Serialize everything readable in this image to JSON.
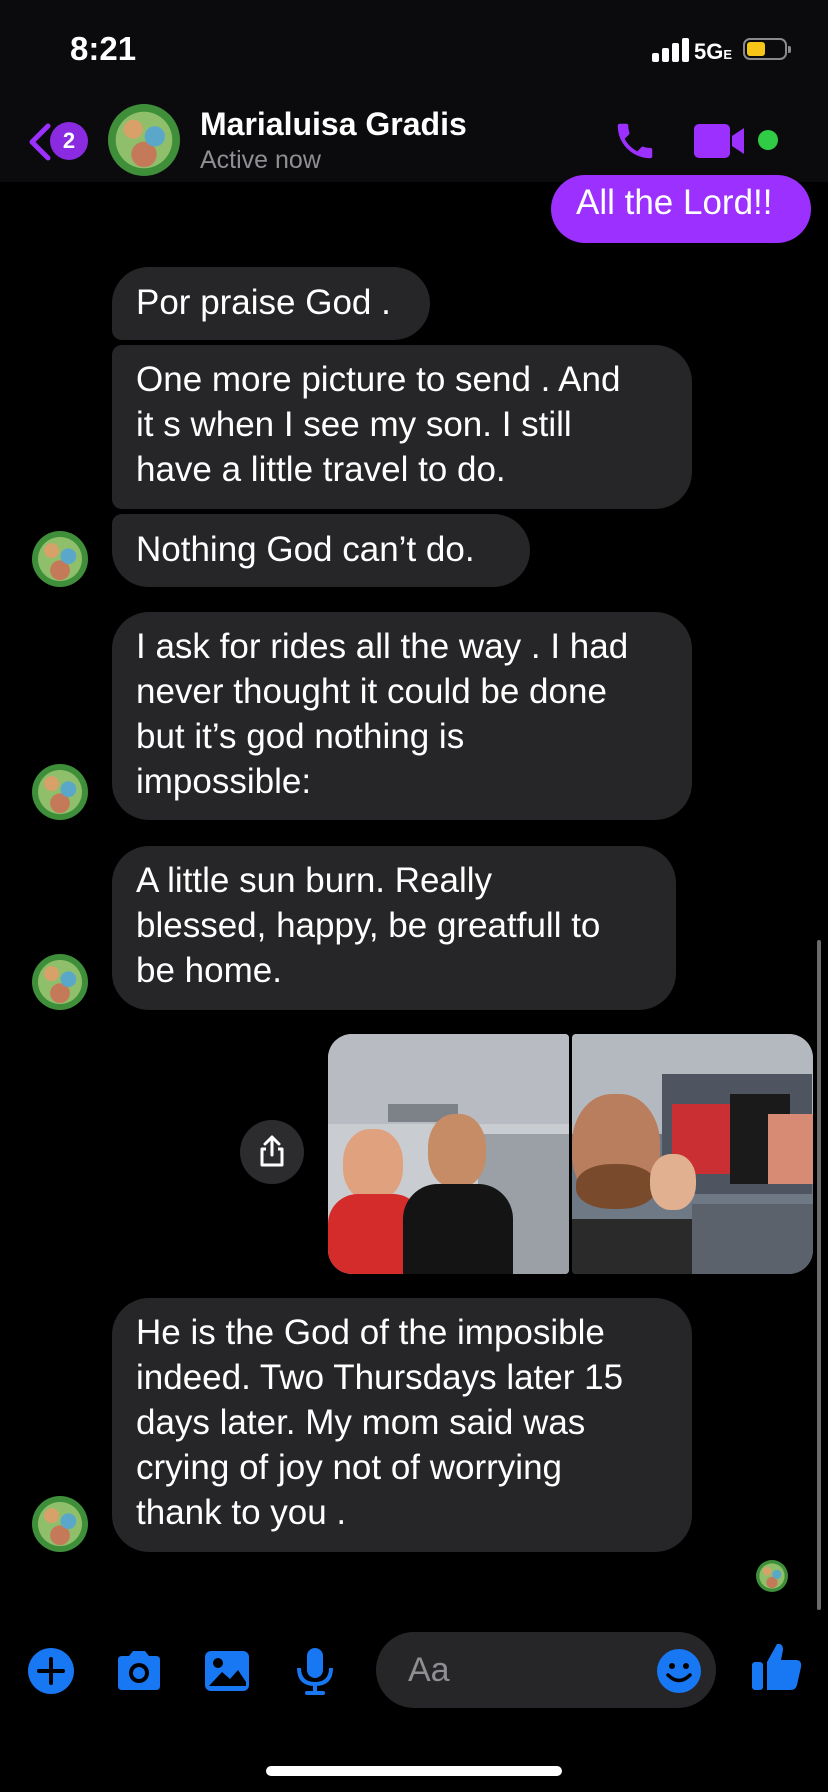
{
  "status_bar": {
    "time": "8:21",
    "network": "5G",
    "network_suffix": "E"
  },
  "header": {
    "back_badge_count": "2",
    "contact_name": "Marialuisa Gradis",
    "contact_status": "Active now"
  },
  "messages": [
    {
      "sender": "me",
      "text": "All the Lord!!"
    },
    {
      "sender": "contact",
      "lines": [
        "Por praise God ."
      ]
    },
    {
      "sender": "contact",
      "lines": [
        "One more picture to send . And",
        "it s when I see my son. I still",
        "have a little travel to do."
      ]
    },
    {
      "sender": "contact",
      "lines": [
        "Nothing God can’t do."
      ]
    },
    {
      "sender": "contact",
      "lines": [
        "I ask for rides all the way . I had",
        "never thought it could be done",
        "but it’s god nothing is",
        "impossible:"
      ]
    },
    {
      "sender": "contact",
      "lines": [
        "A little sun burn. Really",
        "blessed, happy, be greatfull to",
        "be home."
      ]
    },
    {
      "sender": "contact",
      "lines": [
        "He is the God of the imposible",
        "indeed. Two Thursdays later 15",
        "days later. My mom said was",
        "crying of joy not of worrying",
        "thank to you ."
      ]
    }
  ],
  "composer": {
    "placeholder": "Aa"
  },
  "colors": {
    "accent": "#9b30ff",
    "bubble_incoming": "#262628",
    "icon_blue": "#1877f2",
    "active": "#31cc46"
  },
  "icons": [
    "back-chevron-icon",
    "phone-icon",
    "video-camera-icon",
    "share-icon",
    "plus-icon",
    "camera-icon",
    "gallery-icon",
    "microphone-icon",
    "emoji-icon",
    "thumbs-up-icon"
  ]
}
